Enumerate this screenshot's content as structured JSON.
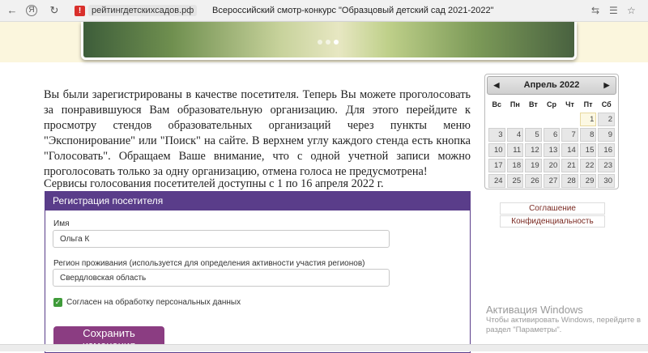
{
  "browser": {
    "url": "рейтингдетскихсадов.рф",
    "title": "Всероссийский смотр-конкурс \"Образцовый детский сад 2021-2022\""
  },
  "content": {
    "intro": "Вы были зарегистрированы в качестве посетителя. Теперь Вы можете проголосовать за понравившуюся Вам образовательную организацию. Для этого перейдите к просмотру стендов образовательных организаций через пункты меню \"Экспонирование\" или \"Поиск\" на сайте. В верхнем углу каждого стенда есть кнопка \"Голосовать\". Обращаем Ваше внимание, что с одной учетной записи можно проголосовать только за одну организацию, отмена голоса не предусмотрена!",
    "voting_dates": "Сервисы голосования посетителей доступны с 1 по 16 апреля 2022 г."
  },
  "registration": {
    "header": "Регистрация посетителя",
    "name_label": "Имя",
    "name_value": "Ольга К",
    "region_label": "Регион проживания (используется для определения активности участия регионов)",
    "region_value": "Свердловская область",
    "consent_label": "Согласен на обработку персональных данных",
    "consent_checked": true,
    "save_label": "Сохранить изменения"
  },
  "calendar": {
    "month": "Апрель 2022",
    "weekdays": [
      "Вс",
      "Пн",
      "Вт",
      "Ср",
      "Чт",
      "Пт",
      "Сб"
    ],
    "weeks": [
      [
        "",
        "",
        "",
        "",
        "",
        "1",
        "2"
      ],
      [
        "3",
        "4",
        "5",
        "6",
        "7",
        "8",
        "9"
      ],
      [
        "10",
        "11",
        "12",
        "13",
        "14",
        "15",
        "16"
      ],
      [
        "17",
        "18",
        "19",
        "20",
        "21",
        "22",
        "23"
      ],
      [
        "24",
        "25",
        "26",
        "27",
        "28",
        "29",
        "30"
      ]
    ],
    "highlight_day": "1"
  },
  "links": {
    "agreement": "Соглашение",
    "privacy": "Конфиденциальность"
  },
  "activation": {
    "title": "Активация Windows",
    "line1": "Чтобы активировать Windows, перейдите в",
    "line2": "раздел \"Параметры\"."
  },
  "colors": {
    "panel_header": "#5a3d8a",
    "save_button": "#8b3d82",
    "checkbox": "#3f9b3a"
  }
}
